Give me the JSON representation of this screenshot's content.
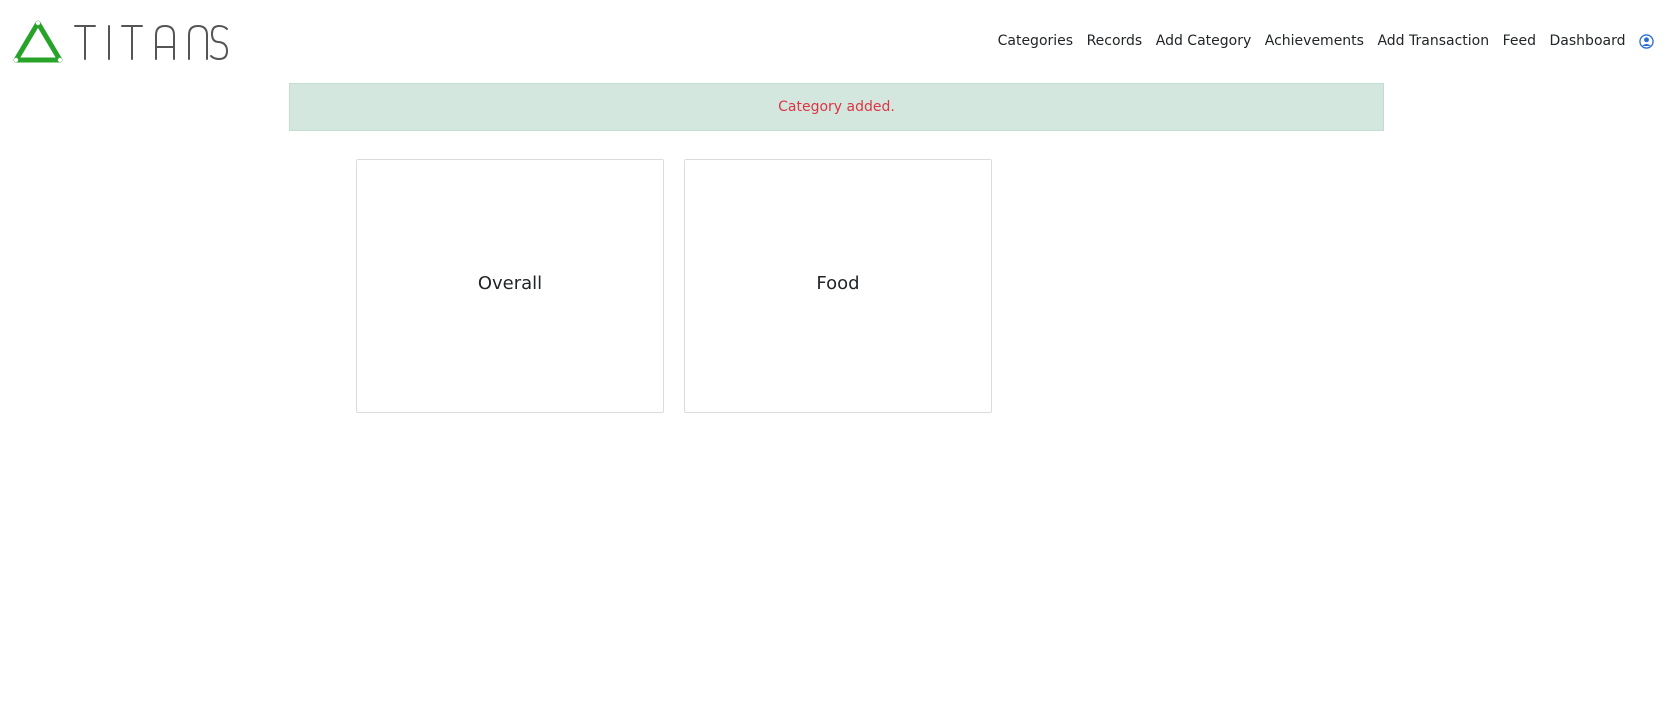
{
  "brand": {
    "name": "TITANS",
    "logo_color": "#27a32a"
  },
  "nav": {
    "items": [
      {
        "label": "Categories"
      },
      {
        "label": "Records"
      },
      {
        "label": "Add Category"
      },
      {
        "label": "Achievements"
      },
      {
        "label": "Add Transaction"
      },
      {
        "label": "Feed"
      },
      {
        "label": "Dashboard"
      }
    ],
    "user_icon": "user-circle-icon"
  },
  "alert": {
    "message": "Category added.",
    "background": "#d4e7de",
    "text_color": "#dc3545"
  },
  "categories": [
    {
      "title": "Overall"
    },
    {
      "title": "Food"
    }
  ]
}
